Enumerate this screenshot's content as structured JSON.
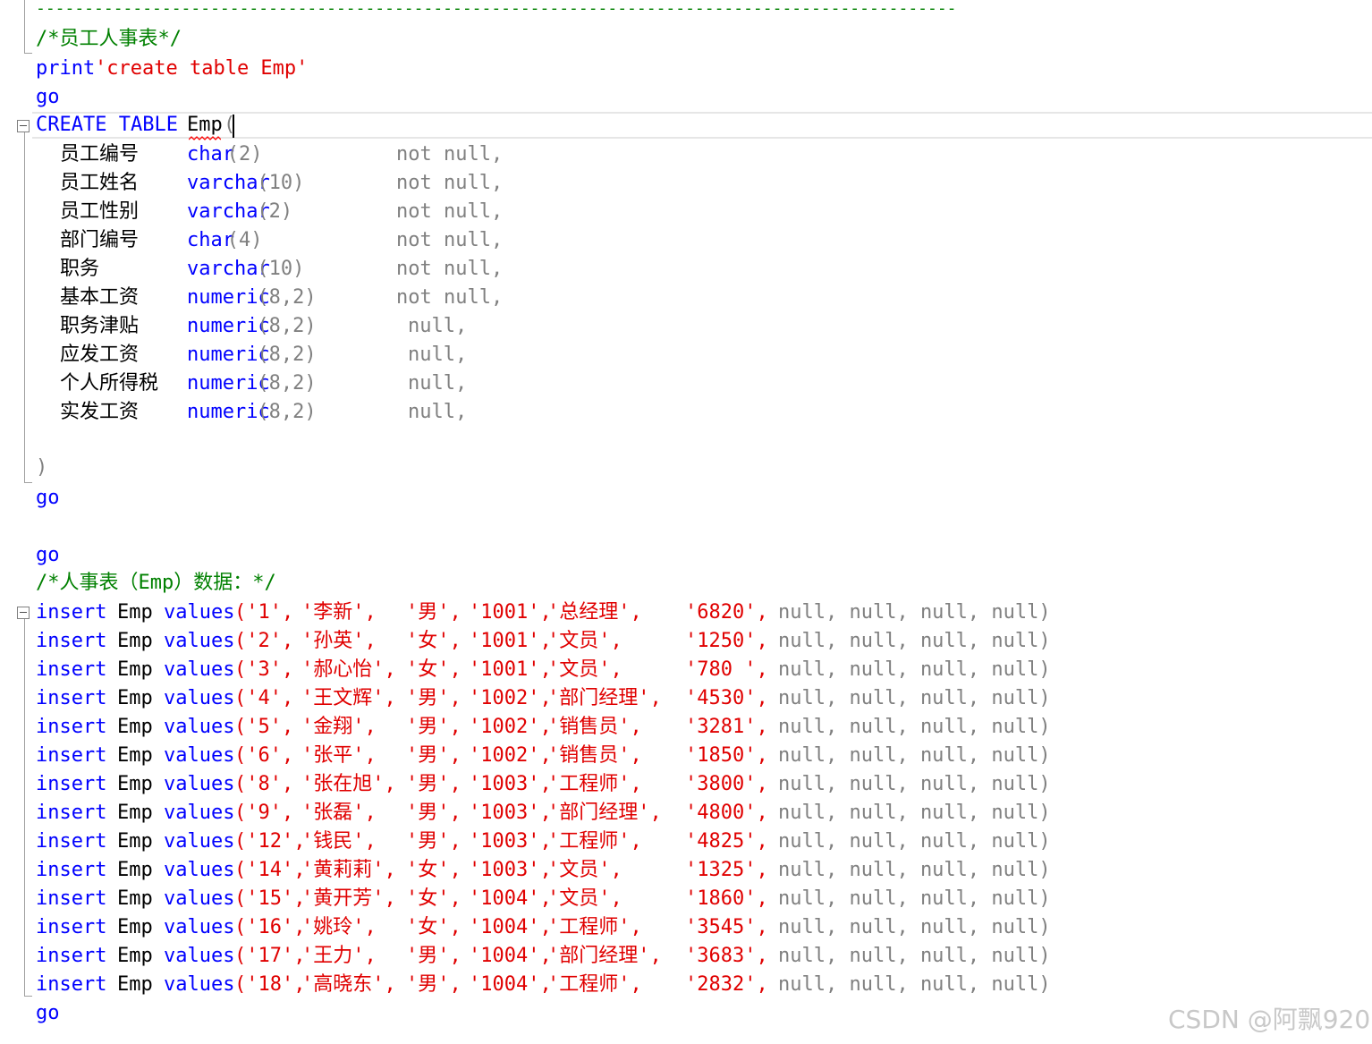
{
  "top_separator": "-----------------------------------------------------------------------------------------------",
  "header_comment": "/*员工人事表*/",
  "print_stmt": {
    "keyword": "print",
    "string": "'create table Emp'"
  },
  "go_label": "go",
  "create_stmt": {
    "keyword": "CREATE TABLE",
    "table": "Emp",
    "paren_open": "(",
    "paren_close": ")"
  },
  "columns": [
    {
      "name": "员工编号",
      "type": "char",
      "size": "(2)",
      "constraint": "not null,"
    },
    {
      "name": "员工姓名",
      "type": "varchar",
      "size": "(10)",
      "constraint": "not null,"
    },
    {
      "name": "员工性别",
      "type": "varchar",
      "size": "(2)",
      "constraint": "not null,"
    },
    {
      "name": "部门编号",
      "type": "char",
      "size": "(4)",
      "constraint": "not null,"
    },
    {
      "name": "职务",
      "type": "varchar",
      "size": "(10)",
      "constraint": "not null,"
    },
    {
      "name": "基本工资",
      "type": "numeric",
      "size": "(8,2)",
      "constraint": "not null,"
    },
    {
      "name": "职务津贴",
      "type": "numeric",
      "size": "(8,2)",
      "constraint": "null,"
    },
    {
      "name": "应发工资",
      "type": "numeric",
      "size": "(8,2)",
      "constraint": "null,"
    },
    {
      "name": "个人所得税",
      "type": "numeric",
      "size": "(8,2)",
      "constraint": "null,"
    },
    {
      "name": "实发工资",
      "type": "numeric",
      "size": "(8,2)",
      "constraint": "null,"
    }
  ],
  "data_comment": "/*人事表（Emp）数据：*/",
  "insert_prefix": {
    "keyword1": "insert",
    "table": "Emp",
    "keyword2": "values"
  },
  "inserts": [
    {
      "id": "('1',",
      "name": "'李新',",
      "sex": "'男',",
      "dept": "'1001',",
      "job": "'总经理',",
      "salary": "'6820',",
      "nulls": "null, null, null, null)"
    },
    {
      "id": "('2',",
      "name": "'孙英',",
      "sex": "'女',",
      "dept": "'1001',",
      "job": "'文员',",
      "salary": "'1250',",
      "nulls": "null, null, null, null)"
    },
    {
      "id": "('3',",
      "name": "'郝心怡',",
      "sex": "'女',",
      "dept": "'1001',",
      "job": "'文员',",
      "salary": "'780 ',",
      "nulls": "null, null, null, null)"
    },
    {
      "id": "('4',",
      "name": "'王文辉',",
      "sex": "'男',",
      "dept": "'1002',",
      "job": "'部门经理',",
      "salary": "'4530',",
      "nulls": "null, null, null, null)"
    },
    {
      "id": "('5',",
      "name": "'金翔',",
      "sex": "'男',",
      "dept": "'1002',",
      "job": "'销售员',",
      "salary": "'3281',",
      "nulls": "null, null, null, null)"
    },
    {
      "id": "('6',",
      "name": "'张平',",
      "sex": "'男',",
      "dept": "'1002',",
      "job": "'销售员',",
      "salary": "'1850',",
      "nulls": "null, null, null, null)"
    },
    {
      "id": "('8',",
      "name": "'张在旭',",
      "sex": "'男',",
      "dept": "'1003',",
      "job": "'工程师',",
      "salary": "'3800',",
      "nulls": "null, null, null, null)"
    },
    {
      "id": "('9',",
      "name": "'张磊',",
      "sex": "'男',",
      "dept": "'1003',",
      "job": "'部门经理',",
      "salary": "'4800',",
      "nulls": "null, null, null, null)"
    },
    {
      "id": "('12',",
      "name": "'钱民',",
      "sex": "'男',",
      "dept": "'1003',",
      "job": "'工程师',",
      "salary": "'4825',",
      "nulls": "null, null, null, null)"
    },
    {
      "id": "('14',",
      "name": "'黄莉莉',",
      "sex": "'女',",
      "dept": "'1003',",
      "job": "'文员',",
      "salary": "'1325',",
      "nulls": "null, null, null, null)"
    },
    {
      "id": "('15',",
      "name": "'黄开芳',",
      "sex": "'女',",
      "dept": "'1004',",
      "job": "'文员',",
      "salary": "'1860',",
      "nulls": "null, null, null, null)"
    },
    {
      "id": "('16',",
      "name": "'姚玲',",
      "sex": "'女',",
      "dept": "'1004',",
      "job": "'工程师',",
      "salary": "'3545',",
      "nulls": "null, null, null, null)"
    },
    {
      "id": "('17',",
      "name": "'王力',",
      "sex": "'男',",
      "dept": "'1004',",
      "job": "'部门经理',",
      "salary": "'3683',",
      "nulls": "null, null, null, null)"
    },
    {
      "id": "('18',",
      "name": "'高晓东',",
      "sex": "'男',",
      "dept": "'1004',",
      "job": "'工程师',",
      "salary": "'2832',",
      "nulls": "null, null, null, null)"
    }
  ],
  "watermark": "CSDN @阿飘920",
  "colors": {
    "keyword": "#0000ff",
    "string": "#e00000",
    "comment": "#008000",
    "muted": "#808080"
  }
}
